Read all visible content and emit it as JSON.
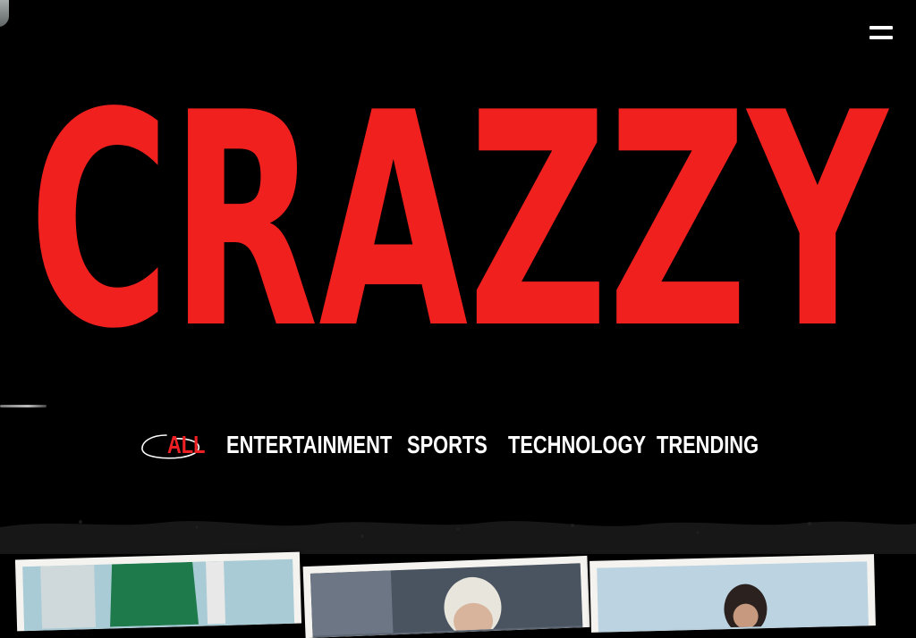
{
  "hero": {
    "title": "CRAZZY",
    "color": "#f0201f"
  },
  "menu": {
    "icon": "hamburger-menu-icon"
  },
  "categories": {
    "active": "ALL",
    "items": [
      "ALL",
      "ENTERTAINMENT",
      "SPORTS",
      "TECHNOLOGY",
      "TRENDING"
    ]
  },
  "colors": {
    "background": "#000000",
    "accent": "#ee2024",
    "nav_text": "#ffffff"
  }
}
